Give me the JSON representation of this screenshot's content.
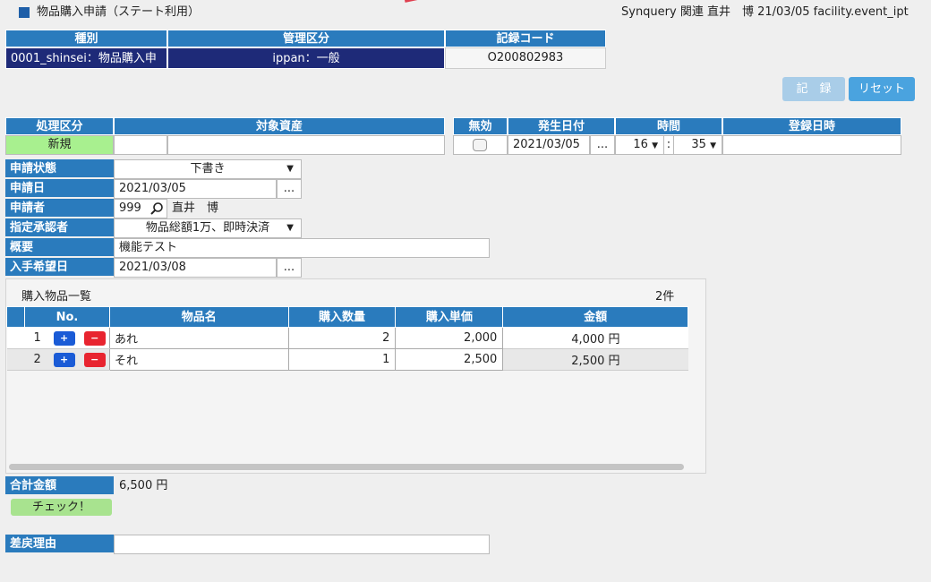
{
  "header": {
    "title": "物品購入申請（ステート利用）",
    "user_info": "Synquery 関連 直井　博 21/03/05 facility.event_ipt"
  },
  "top_table": {
    "col1_header": "種別",
    "col2_header": "管理区分",
    "col3_header": "記録コード",
    "col1_value": "0001_shinsei：物品購入申",
    "col2_value": "ippan：一般",
    "col3_value": "O200802983"
  },
  "buttons": {
    "record": "記　録",
    "reset": "リセット",
    "check": "チェック！"
  },
  "proc_table": {
    "shori_header": "処理区分",
    "taisho_header": "対象資産",
    "shori_value": "新規",
    "mukou_header": "無効",
    "hassei_header": "発生日付",
    "jikan_header": "時間",
    "touroku_header": "登録日時",
    "date_value": "2021/03/05",
    "hour_value": "16",
    "minute_value": "35",
    "colon": ":"
  },
  "form": {
    "status_label": "申請状態",
    "status_value": "下書き",
    "date_label": "申請日",
    "date_value": "2021/03/05",
    "applicant_label": "申請者",
    "applicant_id": "999",
    "applicant_name": "直井　博",
    "approver_label": "指定承認者",
    "approver_value": "物品総額1万、即時決済",
    "summary_label": "概要",
    "summary_value": "機能テスト",
    "desired_label": "入手希望日",
    "desired_value": "2021/03/08"
  },
  "items": {
    "title": "購入物品一覧",
    "count": "2件",
    "columns": [
      "No.",
      "物品名",
      "購入数量",
      "購入単価",
      "金額"
    ],
    "rows": [
      {
        "no": "1",
        "name": "あれ",
        "qty": "2",
        "price": "2,000",
        "amount": "4,000 円"
      },
      {
        "no": "2",
        "name": "それ",
        "qty": "1",
        "price": "2,500",
        "amount": "2,500 円"
      }
    ],
    "plus": "+",
    "minus": "−"
  },
  "total": {
    "label": "合計金額",
    "value": "6,500 円"
  },
  "return_reason": {
    "label": "差戻理由",
    "value": ""
  },
  "glyphs": {
    "ellipsis": "...",
    "caret": "▼"
  },
  "colors": {
    "header_blue": "#2a7bbd",
    "dark_navy": "#1e2a78",
    "new_green": "#a8f08f",
    "record_disabled": "#a9cde8",
    "reset_blue": "#4aa3df",
    "plus_blue": "#1a5bd6",
    "minus_red": "#e8242f"
  }
}
